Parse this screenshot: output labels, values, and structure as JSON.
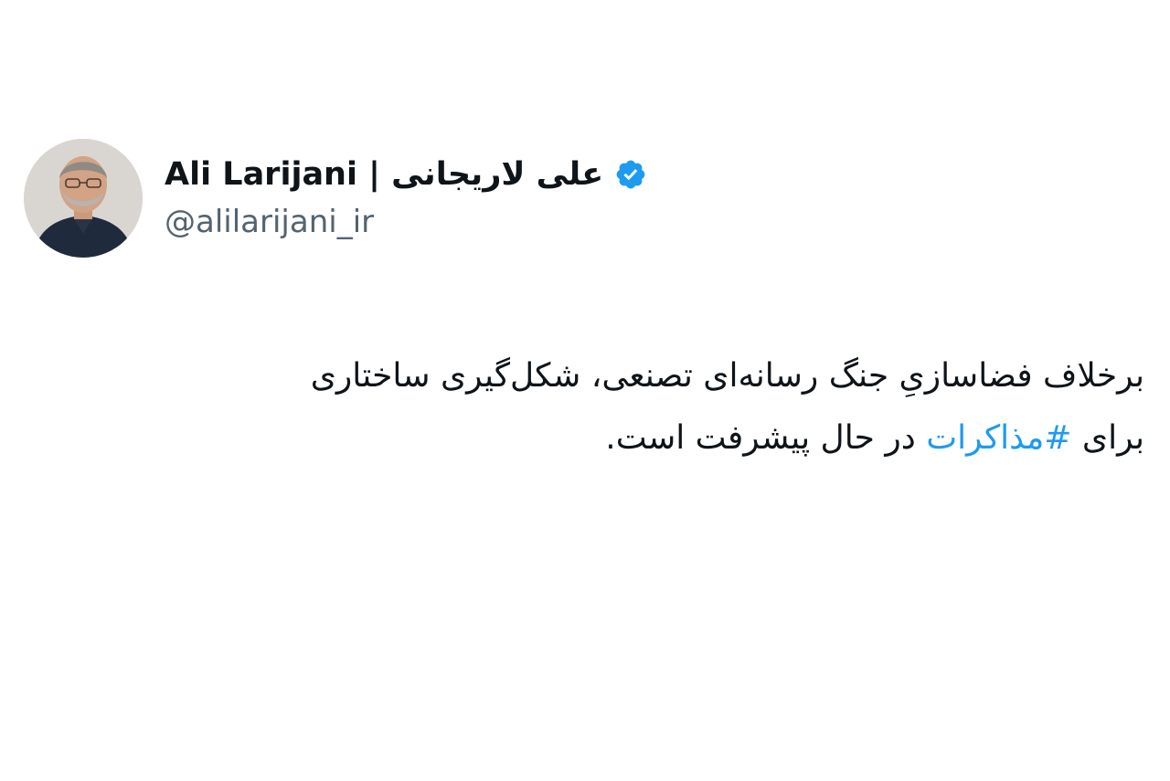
{
  "tweet": {
    "display_name": "Ali Larijani | علی لاریجانی",
    "handle": "@alilarijani_ir",
    "verified_icon": "verified-badge-icon",
    "avatar_icon": "profile-avatar",
    "body": {
      "line1": "برخلاف فضاسازیِ جنگ رسانه‌ای تصنعی، شکل‌گیری ساختاری",
      "line2_before": "برای ",
      "hashtag": "#مذاکرات",
      "line2_after": " در حال پیشرفت است."
    },
    "colors": {
      "text": "#0f1419",
      "handle": "#536471",
      "link": "#1d9bf0",
      "verified": "#1d9bf0"
    }
  }
}
